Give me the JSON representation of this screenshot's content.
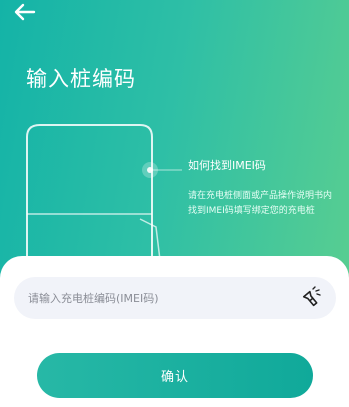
{
  "page": {
    "title": "输入桩编码"
  },
  "help": {
    "title": "如何找到IMEI码",
    "text": "请在充电桩侧面或产品操作说明书内找到IMEI码填写绑定您的充电桩"
  },
  "form": {
    "input_value": "",
    "input_placeholder": "请输入充电桩编码(IMEI码)",
    "confirm_label": "确认"
  },
  "icons": {
    "back": "back-arrow-icon",
    "flashlight": "flashlight-icon"
  },
  "colors": {
    "gradient_start": "#14b3a7",
    "gradient_end": "#5ccf8f",
    "button": "#18ad9d"
  }
}
